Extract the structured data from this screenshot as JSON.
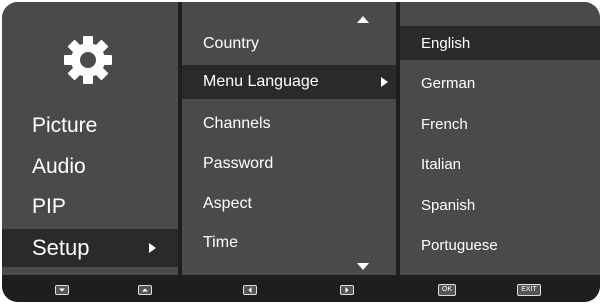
{
  "main_menu": {
    "icon": "gear-icon",
    "items": [
      "Picture",
      "Audio",
      "PIP",
      "Setup"
    ],
    "selected": "Setup"
  },
  "setup_menu": {
    "items": [
      "Country",
      "Menu Language",
      "Channels",
      "Password",
      "Aspect",
      "Time"
    ],
    "selected": "Menu Language"
  },
  "language_menu": {
    "items": [
      "English",
      "German",
      "French",
      "Italian",
      "Spanish",
      "Portuguese"
    ],
    "selected": "English"
  },
  "bottom_bar": {
    "buttons": [
      "down-button-icon",
      "up-button-icon",
      "left-button-icon",
      "right-button-icon"
    ],
    "ok_label": "OK",
    "exit_label": "EXIT"
  },
  "colors": {
    "background": "#1e1e1e",
    "panel": "#4a4a4a",
    "highlight": "#2a2a2a",
    "text": "#ffffff"
  }
}
